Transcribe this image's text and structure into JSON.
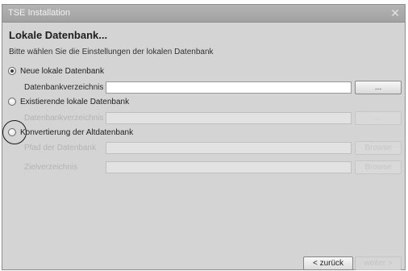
{
  "window": {
    "title": "TSE Installation",
    "close_glyph": "✕"
  },
  "page": {
    "heading": "Lokale Datenbank...",
    "subtitle": "Bitte wählen Sie die Einstellungen der lokalen Datenbank"
  },
  "options": [
    {
      "label": "Neue lokale Datenbank",
      "selected": true,
      "fields": [
        {
          "label": "Datenbankverzeichnis",
          "value": "",
          "enabled": true,
          "button_label": "..."
        }
      ]
    },
    {
      "label": "Existierende lokale Datenbank",
      "selected": false,
      "fields": [
        {
          "label": "Datenbankverzeichnis",
          "value": "",
          "enabled": false,
          "button_label": "..."
        }
      ]
    },
    {
      "label": "Konvertierung der Altdatenbank",
      "selected": false,
      "fields": [
        {
          "label": "Pfad der Datenbank",
          "value": "",
          "enabled": false,
          "button_label": "Browse"
        },
        {
          "label": "Zielverzeichnis",
          "value": "",
          "enabled": false,
          "button_label": "Browse"
        }
      ]
    }
  ],
  "footer": {
    "back_label": "< zurück",
    "next_label": "weiter >"
  }
}
